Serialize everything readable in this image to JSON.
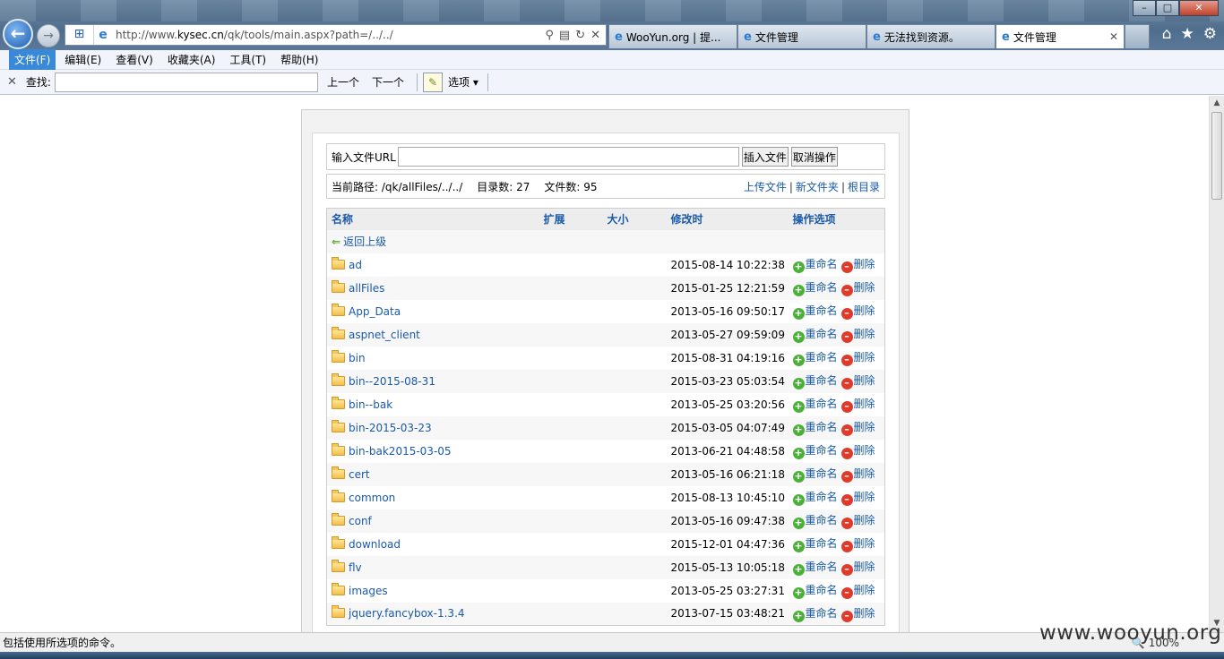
{
  "browser": {
    "address": {
      "prefix": "http://www.",
      "domain": "kysec.cn",
      "path": "/qk/tools/main.aspx?path=/../../"
    },
    "tabs": [
      {
        "label": "WooYun.org | 提..."
      },
      {
        "label": "文件管理"
      },
      {
        "label": "无法找到资源。"
      },
      {
        "label": "文件管理"
      }
    ],
    "menu": [
      "文件(F)",
      "编辑(E)",
      "查看(V)",
      "收藏夹(A)",
      "工具(T)",
      "帮助(H)"
    ],
    "find": {
      "label": "查找:",
      "value": "",
      "prev": "上一个",
      "next": "下一个",
      "options": "选项"
    },
    "status_text": "包括使用所选项的命令。",
    "zoom": "100%",
    "watermark": "www.wooyun.org"
  },
  "manager": {
    "url_label": "输入文件URL",
    "url_value": "",
    "insert_button": "插入文件",
    "cancel_button": "取消操作",
    "path_label": "当前路径: /qk/allFiles/../../",
    "dir_count": "目录数: 27",
    "file_count": "文件数: 95",
    "upload": "上传文件",
    "new_folder": "新文件夹",
    "root": "根目录",
    "headers": {
      "name": "名称",
      "ext": "扩展",
      "size": "大小",
      "modified": "修改时",
      "ops": "操作选项"
    },
    "back": "返回上级",
    "rename": "重命名",
    "delete": "删除",
    "rows": [
      {
        "name": "ad",
        "time": "2015-08-14 10:22:38"
      },
      {
        "name": "allFiles",
        "time": "2015-01-25 12:21:59"
      },
      {
        "name": "App_Data",
        "time": "2013-05-16 09:50:17"
      },
      {
        "name": "aspnet_client",
        "time": "2013-05-27 09:59:09"
      },
      {
        "name": "bin",
        "time": "2015-08-31 04:19:16"
      },
      {
        "name": "bin--2015-08-31",
        "time": "2015-03-23 05:03:54"
      },
      {
        "name": "bin--bak",
        "time": "2013-05-25 03:20:56"
      },
      {
        "name": "bin-2015-03-23",
        "time": "2015-03-05 04:07:49"
      },
      {
        "name": "bin-bak2015-03-05",
        "time": "2013-06-21 04:48:58"
      },
      {
        "name": "cert",
        "time": "2013-05-16 06:21:18"
      },
      {
        "name": "common",
        "time": "2015-08-13 10:45:10"
      },
      {
        "name": "conf",
        "time": "2013-05-16 09:47:38"
      },
      {
        "name": "download",
        "time": "2015-12-01 04:47:36"
      },
      {
        "name": "flv",
        "time": "2015-05-13 10:05:18"
      },
      {
        "name": "images",
        "time": "2013-05-25 03:27:31"
      },
      {
        "name": "jquery.fancybox-1.3.4",
        "time": "2013-07-15 03:48:21"
      }
    ]
  }
}
